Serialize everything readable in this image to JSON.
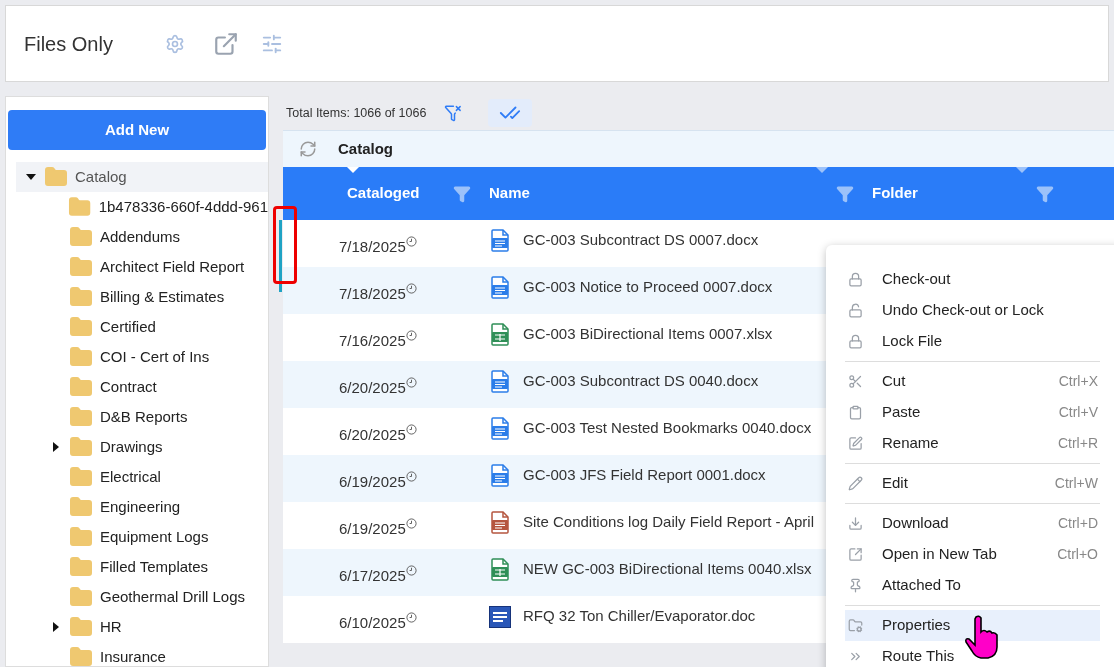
{
  "header": {
    "title": "Files Only"
  },
  "sidebar": {
    "add_button": "Add New",
    "tree": [
      {
        "label": "Catalog",
        "kind": "branch",
        "expanded": true,
        "selected": true,
        "children": [
          {
            "label": "1b478336-660f-4ddd-961",
            "kind": "leaf"
          },
          {
            "label": "Addendums",
            "kind": "leaf"
          },
          {
            "label": "Architect Field Report",
            "kind": "leaf"
          },
          {
            "label": "Billing & Estimates",
            "kind": "leaf"
          },
          {
            "label": "Certified",
            "kind": "leaf"
          },
          {
            "label": "COI - Cert of Ins",
            "kind": "leaf"
          },
          {
            "label": "Contract",
            "kind": "leaf"
          },
          {
            "label": "D&B Reports",
            "kind": "leaf"
          },
          {
            "label": "Drawings",
            "kind": "branch",
            "expanded": false
          },
          {
            "label": "Electrical",
            "kind": "leaf"
          },
          {
            "label": "Engineering",
            "kind": "leaf"
          },
          {
            "label": "Equipment Logs",
            "kind": "leaf"
          },
          {
            "label": "Filled Templates",
            "kind": "leaf"
          },
          {
            "label": "Geothermal Drill Logs",
            "kind": "leaf"
          },
          {
            "label": "HR",
            "kind": "branch",
            "expanded": false
          },
          {
            "label": "Insurance",
            "kind": "leaf"
          }
        ]
      }
    ]
  },
  "grid": {
    "total": "Total Items: 1066 of 1066",
    "group": "Catalog",
    "columns": [
      {
        "label": "Cataloged",
        "sorted": true
      },
      {
        "label": "Name",
        "sorted": false
      },
      {
        "label": "Folder",
        "sorted": false
      }
    ],
    "rows": [
      {
        "date": "7/18/2025",
        "kind": "word",
        "name": "GC-003 Subcontract DS 0007.docx"
      },
      {
        "date": "7/18/2025",
        "kind": "word",
        "name": "GC-003 Notice to Proceed 0007.docx"
      },
      {
        "date": "7/16/2025",
        "kind": "excel",
        "name": "GC-003 BiDirectional Items 0007.xlsx"
      },
      {
        "date": "6/20/2025",
        "kind": "word",
        "name": "GC-003 Subcontract DS 0040.docx"
      },
      {
        "date": "6/20/2025",
        "kind": "word",
        "name": "GC-003 Test Nested Bookmarks 0040.docx"
      },
      {
        "date": "6/19/2025",
        "kind": "word",
        "name": "GC-003 JFS Field Report 0001.docx"
      },
      {
        "date": "6/19/2025",
        "kind": "pdf",
        "name": "Site Conditions log Daily Field Report - April"
      },
      {
        "date": "6/17/2025",
        "kind": "excel",
        "name": "NEW GC-003 BiDirectional Items 0040.xlsx"
      },
      {
        "date": "6/10/2025",
        "kind": "legacy",
        "name": "RFQ 32 Ton Chiller/Evaporator.doc"
      }
    ]
  },
  "context_menu": {
    "groups": [
      [
        {
          "label": "Check-out",
          "selected": false
        },
        {
          "label": "Undo Check-out or Lock",
          "selected": false
        },
        {
          "label": "Lock File",
          "selected": false
        }
      ],
      [
        {
          "label": "Cut",
          "shortcut": "Ctrl+X",
          "selected": false
        },
        {
          "label": "Paste",
          "shortcut": "Ctrl+V",
          "selected": false
        },
        {
          "label": "Rename",
          "shortcut": "Ctrl+R",
          "selected": false
        }
      ],
      [
        {
          "label": "Edit",
          "shortcut": "Ctrl+W",
          "selected": false
        }
      ],
      [
        {
          "label": "Download",
          "shortcut": "Ctrl+D",
          "selected": false
        },
        {
          "label": "Open in New Tab",
          "shortcut": "Ctrl+O",
          "selected": false
        },
        {
          "label": "Attached To",
          "selected": false
        }
      ],
      [
        {
          "label": "Properties",
          "selected": true
        },
        {
          "label": "Route This",
          "selected": false
        }
      ]
    ]
  }
}
